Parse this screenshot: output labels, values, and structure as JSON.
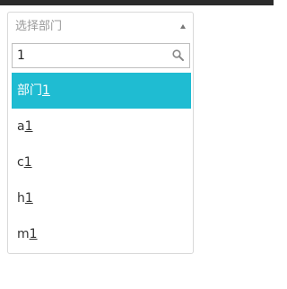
{
  "dropdown": {
    "placeholder": "选择部门",
    "search": {
      "value": "1"
    },
    "options": [
      {
        "prefix": "部门",
        "match": "1",
        "selected": true
      },
      {
        "prefix": "a",
        "match": "1",
        "selected": false
      },
      {
        "prefix": "c",
        "match": "1",
        "selected": false
      },
      {
        "prefix": "h",
        "match": "1",
        "selected": false
      },
      {
        "prefix": "m",
        "match": "1",
        "selected": false
      }
    ]
  },
  "colors": {
    "highlight": "#1fbcd2",
    "border": "#d9d9d9",
    "placeholder_text": "#999999"
  },
  "icons": {
    "caret": "caret-up-icon",
    "search": "search-icon"
  }
}
